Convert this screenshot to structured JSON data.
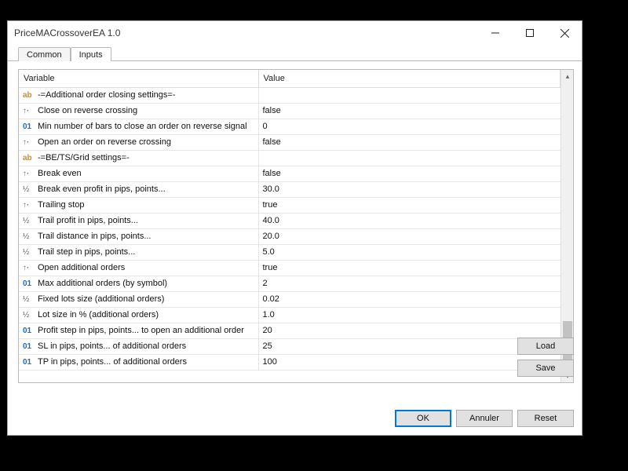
{
  "window": {
    "title": "PriceMACrossoverEA 1.0"
  },
  "tabs": {
    "common": "Common",
    "inputs": "Inputs"
  },
  "columns": {
    "variable": "Variable",
    "value": "Value"
  },
  "rows": [
    {
      "icon": "ab",
      "name": "-=Additional order closing settings=-",
      "value": ""
    },
    {
      "icon": "bool",
      "name": "Close on reverse crossing",
      "value": "false"
    },
    {
      "icon": "int",
      "name": "Min number of bars to close an order on reverse signal",
      "value": "0"
    },
    {
      "icon": "bool",
      "name": "Open an order on reverse crossing",
      "value": "false"
    },
    {
      "icon": "ab",
      "name": "-=BE/TS/Grid settings=-",
      "value": ""
    },
    {
      "icon": "bool",
      "name": "Break even",
      "value": "false"
    },
    {
      "icon": "frac",
      "name": "Break even profit in pips, points...",
      "value": "30.0"
    },
    {
      "icon": "bool",
      "name": "Trailing stop",
      "value": "true"
    },
    {
      "icon": "frac",
      "name": "Trail profit in pips, points...",
      "value": "40.0"
    },
    {
      "icon": "frac",
      "name": "Trail distance in pips, points...",
      "value": "20.0"
    },
    {
      "icon": "frac",
      "name": "Trail step in pips, points...",
      "value": "5.0"
    },
    {
      "icon": "bool",
      "name": "Open additional orders",
      "value": "true"
    },
    {
      "icon": "int",
      "name": "Max additional orders (by symbol)",
      "value": "2"
    },
    {
      "icon": "frac",
      "name": "Fixed lots size (additional orders)",
      "value": "0.02"
    },
    {
      "icon": "frac",
      "name": "Lot size in % (additional orders)",
      "value": "1.0"
    },
    {
      "icon": "int",
      "name": "Profit step in pips, points... to open an additional order",
      "value": "20"
    },
    {
      "icon": "int",
      "name": "SL in pips, points... of additional orders",
      "value": "25"
    },
    {
      "icon": "int",
      "name": "TP in pips, points... of additional orders",
      "value": "100"
    }
  ],
  "buttons": {
    "load": "Load",
    "save": "Save",
    "ok": "OK",
    "cancel": "Annuler",
    "reset": "Reset"
  }
}
